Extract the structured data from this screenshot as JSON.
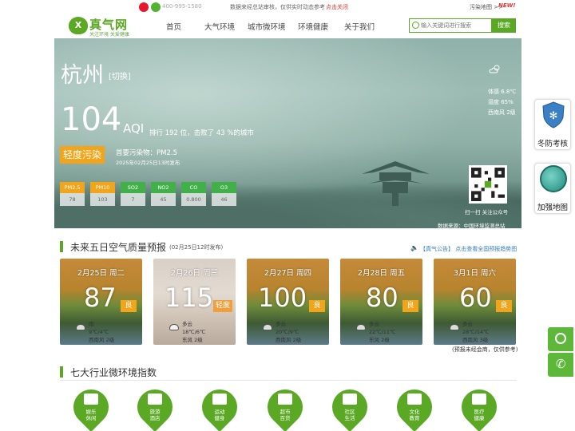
{
  "topbar": {
    "phone": "400-995-1580",
    "notice": "数据来经总站审核，仅供实时动态参考",
    "notice_link": "点击关闭",
    "sitemap": "污染地图 >>",
    "new_badge": "NEW!"
  },
  "logo": {
    "mark": "X",
    "name": "真气网",
    "slogan": "关注环境 关爱健康"
  },
  "nav": [
    "首页",
    "大气环境",
    "城市微环境",
    "环境健康",
    "关于我们"
  ],
  "search": {
    "placeholder": "输入关键词进行搜索",
    "button": "搜索"
  },
  "hero": {
    "city": "杭州",
    "switch": "[切换]",
    "aqi": "104",
    "aqi_unit": "AQI",
    "rank_text": "排行 192 位，击败了 43 %的城市",
    "level": "轻度污染",
    "primary": "首要污染物：PM2.5",
    "published": "2025年02月25日13时发布",
    "pollutants": [
      {
        "name": "PM2.5",
        "value": "78",
        "color": "#f2a51a"
      },
      {
        "name": "PM10",
        "value": "103",
        "color": "#f2a51a"
      },
      {
        "name": "SO2",
        "value": "7",
        "color": "#41b049"
      },
      {
        "name": "NO2",
        "value": "45",
        "color": "#41b049"
      },
      {
        "name": "CO",
        "value": "0.800",
        "color": "#41b049"
      },
      {
        "name": "O3",
        "value": "46",
        "color": "#41b049"
      }
    ],
    "weather": {
      "icon": "partly-cloudy-icon",
      "temp": "体感 6.8℃",
      "humidity": "湿度 65%",
      "wind": "西南风 2级"
    },
    "qr_caption": "扫一扫 关注公众号",
    "source": "数据来源：中国环境监测总站"
  },
  "side": {
    "badge1": "冬防考核",
    "badge2": "加强地图"
  },
  "forecast": {
    "title": "未来五日空气质量预报",
    "title_sub": "(02月25日12时发布)",
    "notice": "【真气公告】 点击查看全国预报趋势图",
    "disclaimer": "(预报未经会商，仅供参考)",
    "days": [
      {
        "date": "2月25日 周二",
        "aqi": "87",
        "level": "良",
        "level_color": "#f2a51a",
        "weather": "雨",
        "temp": "9℃/4℃",
        "wind": "西南风 2级"
      },
      {
        "date": "2月26日 周三",
        "aqi": "115",
        "level": "轻度",
        "level_color": "#f0a03a",
        "weather": "多云",
        "temp": "18℃/6℃",
        "wind": "东风 2级"
      },
      {
        "date": "2月27日 周四",
        "aqi": "100",
        "level": "良",
        "level_color": "#f2a51a",
        "weather": "多云",
        "temp": "20℃/9℃",
        "wind": "西南风 2级"
      },
      {
        "date": "2月28日 周五",
        "aqi": "80",
        "level": "良",
        "level_color": "#f2a51a",
        "weather": "多云",
        "temp": "22℃/11℃",
        "wind": "东风 2级"
      },
      {
        "date": "3月1日 周六",
        "aqi": "60",
        "level": "良",
        "level_color": "#f2a51a",
        "weather": "多云",
        "temp": "28℃/14℃",
        "wind": "西南风 3级"
      }
    ]
  },
  "industry": {
    "title": "七大行业微环境指数",
    "items": [
      {
        "label": "娱乐\n休闲",
        "icon": "people-icon"
      },
      {
        "label": "旅游\n酒店",
        "icon": "luggage-icon"
      },
      {
        "label": "运动\n健身",
        "icon": "runner-icon"
      },
      {
        "label": "超市\n百货",
        "icon": "bottles-icon"
      },
      {
        "label": "社区\n生活",
        "icon": "building-icon"
      },
      {
        "label": "文化\n教育",
        "icon": "book-icon"
      },
      {
        "label": "医疗\n健康",
        "icon": "medicine-icon"
      }
    ]
  }
}
